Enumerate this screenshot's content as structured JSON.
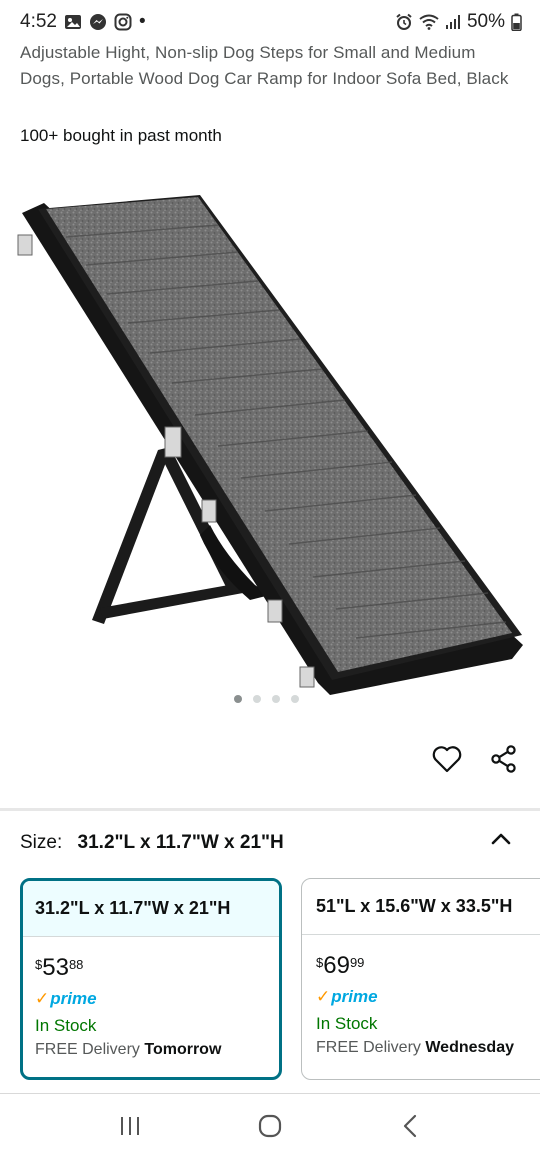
{
  "status_bar": {
    "time": "4:52",
    "dot": "•",
    "battery": "50%",
    "icons": [
      "gallery-icon",
      "messenger-icon",
      "instagram-icon",
      "alarm-icon",
      "wifi-icon",
      "signal-icon",
      "battery-icon"
    ]
  },
  "product": {
    "title": "Adjustable Hight, Non-slip Dog Steps for Small and Medium Dogs, Portable Wood Dog Car Ramp for Indoor Sofa Bed, Black",
    "bought": "100+ bought in past month",
    "image_count": 4,
    "active_image": 0
  },
  "size": {
    "label": "Size:",
    "selected": "31.2\"L x 11.7\"W x 21\"H"
  },
  "options": [
    {
      "name": "31.2\"L x 11.7\"W x 21\"H",
      "price_currency": "$",
      "price_whole": "53",
      "price_fraction": "88",
      "prime_check": "✓",
      "prime": "prime",
      "stock": "In Stock",
      "delivery_prefix": "FREE Delivery ",
      "delivery_day": "Tomorrow"
    },
    {
      "name": "51\"L x 15.6\"W x 33.5\"H",
      "price_currency": "$",
      "price_whole": "69",
      "price_fraction": "99",
      "prime_check": "✓",
      "prime": "prime",
      "stock": "In Stock",
      "delivery_prefix": "FREE Delivery ",
      "delivery_day": "Wednesday"
    }
  ],
  "colors": {
    "accent_teal": "#007185",
    "selected_bg": "#edfdff",
    "prime_blue": "#00a8e1",
    "prime_check": "#ff9900",
    "stock_green": "#007600"
  }
}
